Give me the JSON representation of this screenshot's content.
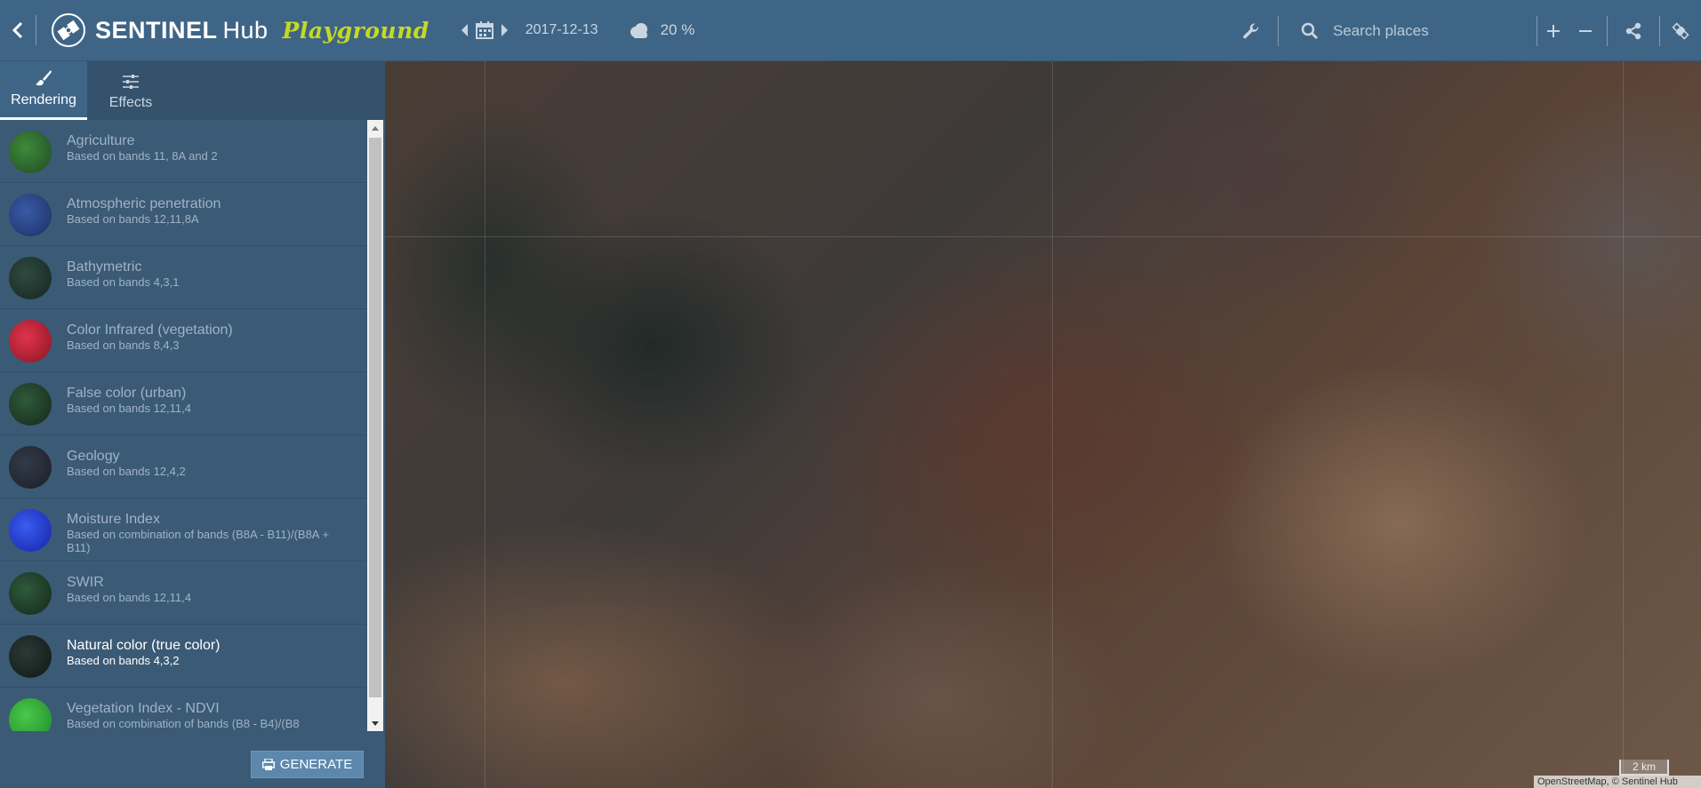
{
  "header": {
    "logo_name": "SENTINEL",
    "logo_hub": "Hub",
    "logo_playground": "Playground",
    "date": "2017-12-13",
    "cloud_coverage": "20 %",
    "search_placeholder": "Search places"
  },
  "tabs": [
    {
      "label": "Rendering",
      "active": true
    },
    {
      "label": "Effects",
      "active": false
    }
  ],
  "presets": [
    {
      "title": "Agriculture",
      "desc": "Based on bands 11, 8A and 2"
    },
    {
      "title": "Atmospheric penetration",
      "desc": "Based on bands 12,11,8A"
    },
    {
      "title": "Bathymetric",
      "desc": "Based on bands 4,3,1"
    },
    {
      "title": "Color Infrared (vegetation)",
      "desc": "Based on bands 8,4,3"
    },
    {
      "title": "False color (urban)",
      "desc": "Based on bands 12,11,4"
    },
    {
      "title": "Geology",
      "desc": "Based on bands 12,4,2"
    },
    {
      "title": "Moisture Index",
      "desc": "Based on combination of bands (B8A - B11)/(B8A + B11)"
    },
    {
      "title": "SWIR",
      "desc": "Based on bands 12,11,4"
    },
    {
      "title": "Natural color (true color)",
      "desc": "Based on bands 4,3,2"
    },
    {
      "title": "Vegetation Index - NDVI",
      "desc": "Based on combination of bands (B8 - B4)/(B8"
    }
  ],
  "active_preset": "Natural color (true color)",
  "generate_label": "GENERATE",
  "map": {
    "scale_label": "2 km",
    "attribution": "OpenStreetMap, © Sentinel Hub"
  },
  "colors": {
    "topbar": "#3f6586",
    "sidebar": "#3a5a76",
    "accent_playground": "#c6d925"
  }
}
